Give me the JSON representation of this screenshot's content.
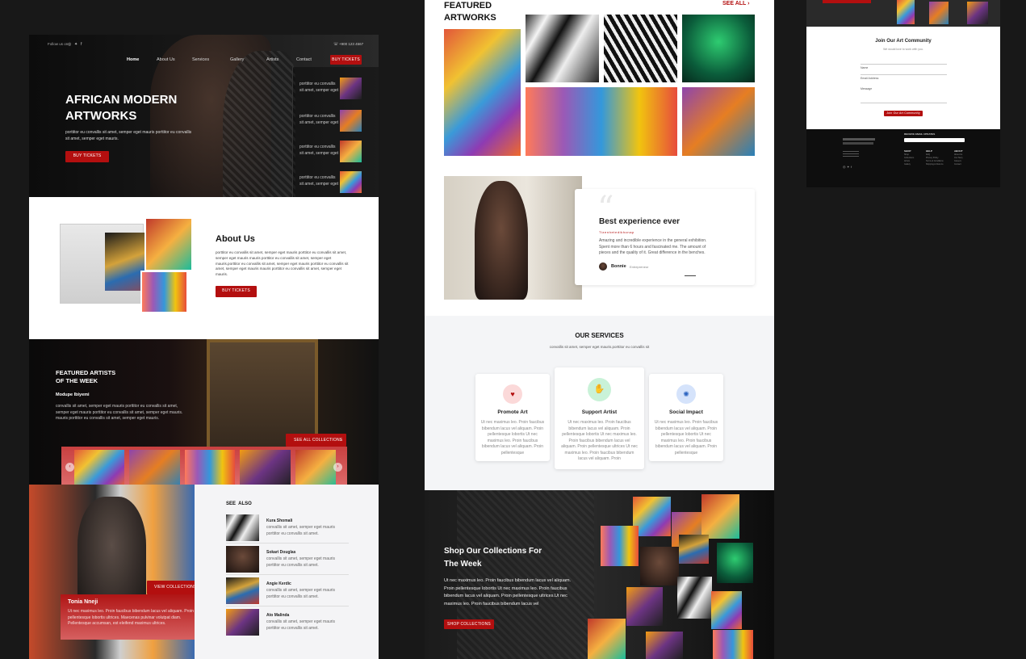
{
  "left": {
    "hero": {
      "follow": "Follow us on",
      "phone": "+900 123 4567",
      "nav": [
        "Home",
        "About Us",
        "Services",
        "Gallery",
        "Artists",
        "Contact"
      ],
      "nav_btn": "BUY TICKETS",
      "title_1": "AFRICAN MODERN",
      "title_2": "ARTWORKS",
      "text": "porttitor eu convallis sit amet, semper eget mauris porttitor eu convallis sit amet, semper eget mauris.",
      "btn": "BUY TICKETS",
      "side_items": [
        "porttitor eu convallis sit amet, semper eget",
        "porttitor eu convallis sit amet, semper eget",
        "porttitor eu convallis sit amet, semper eget",
        "porttitor eu convallis sit amet, semper eget"
      ]
    },
    "about": {
      "title": "About Us",
      "text": "porttitor eu convallis sit amet, semper eget mauris porttitor eu convallis sit amet, semper eget mauris mauris porttitor eu convallis sit amet, semper eget mauris.porttitor eu convallis sit amet, semper eget mauris porttitor eu convallis sit amet, semper eget mauris mauris porttitor eu convallis sit amet, semper eget mauris.",
      "btn": "BUY TICKETS"
    },
    "featured": {
      "title_1": "FEATURED ARTISTS",
      "title_2": "OF THE WEEK",
      "artist": "Modupe Ibiyemi",
      "text": "convallis sit amet, semper eget mauris porttitor eu convallis sit amet, semper eget mauris porttitor eu convallis sit amet, semper eget mauris. mauris porttitor eu convallis sit amet, semper eget mauris.",
      "btn": "SEE ALL COLLECTIONS"
    },
    "tonia": {
      "name": "Tonia Nneji",
      "text": "Ut nec maximus leo. Proin faucibus bibendum lacus vel aliquam. Proin pellentesque lobortis ultrices. Maecenas pulvinar volutpat diam. Pellentesque accumsan, est eleifend maximus ultrices.",
      "btn": "VIEW COLLECTIONS"
    },
    "see_also": {
      "title": "SEE  ALSO",
      "items": [
        {
          "name": "Kura Shomali",
          "text": "convallis sit amet, semper eget mauris porttitor eu convallis sit amet."
        },
        {
          "name": "Sokari Douglas",
          "text": "convallis sit amet, semper eget mauris porttitor eu convallis sit amet."
        },
        {
          "name": "Angie Kerdic",
          "text": "convallis sit amet, semper eget mauris porttitor eu convallis sit amet."
        },
        {
          "name": "Ato Malinda",
          "text": "convallis sit amet, semper eget mauris porttitor eu convallis sit amet."
        }
      ]
    }
  },
  "middle": {
    "featured": {
      "title_1": "FEATURED",
      "title_2": "ARTWORKS",
      "see_all": "SEE ALL"
    },
    "testimonial": {
      "title": "Best experience ever",
      "sub": "Tizenhetedikhonap",
      "text": "Amazing and incredible experience in the general exhibition. Spent more than 6 hours and fascinated me. The amount of pieces and the quality of it. Great difference in the benches.",
      "name": "Bonnie",
      "role": "Entrepreneur"
    },
    "services": {
      "title": "OUR SERVICES",
      "sub": "convallis sit amet, semper eget mauris.porttitor eu convallis sit",
      "cards": [
        {
          "title": "Promote Art",
          "text": "Ut nec maximus leo. Proin faucibus bibendum lacus vel aliquam. Proin pellentesque lobortis Ut nec maximus leo. Proin faucibus bibendum lacus vel aliquam. Proin pellentesque"
        },
        {
          "title": "Support Artist",
          "text": "Ut nec maximus leo. Proin faucibus bibendum lacus vel aliquam. Proin pellentesque lobortis Ut nec maximus leo. Proin faucibus bibendum lacus vel aliquam. Proin pellentesque ultrices Ut nec maximus leo. Proin faucibus bibendum lacus vel aliquam. Proin"
        },
        {
          "title": "Social Impact",
          "text": "Ut nec maximus leo. Proin faucibus bibendum lacus vel aliquam. Proin pellentesque lobortis Ut nec maximus leo. Proin faucibus bibendum lacus vel aliquam. Proin pellentesque"
        }
      ]
    },
    "shop": {
      "title_1": "Shop Our Collections For",
      "title_2": "The Week",
      "text": "Ut nec maximus leo. Proin faucibus bibendum lacus vel aliquam. Proin pellentesque lobortis Ut nec maximus leo. Proin faucibus bibendum lacus vel aliquam. Proin pellentesque ultrices.Ut nec maximus leo. Proin faucibus bibendum lacus vel",
      "btn": "SHOP COLLECTIONS"
    }
  },
  "right": {
    "community": {
      "title": "Join Our Art Community",
      "sub": "We would love to work with you.",
      "fields": [
        "Name",
        "Email Address",
        "Message"
      ],
      "btn": "Join Our Art Community"
    },
    "footer": {
      "newsletter": "RECEIVE EMAIL UPDATES",
      "cols": [
        {
          "head": "SHOP",
          "items": [
            "Shop",
            "Collections",
            "Artists",
            "Gallery"
          ]
        },
        {
          "head": "HELP",
          "items": [
            "FAQ",
            "Privacy Policy",
            "Terms & Conditions",
            "Shipping & Returns"
          ]
        },
        {
          "head": "ABOUT",
          "items": [
            "About Us",
            "Our Story",
            "Careers",
            "Contact"
          ]
        }
      ]
    }
  }
}
